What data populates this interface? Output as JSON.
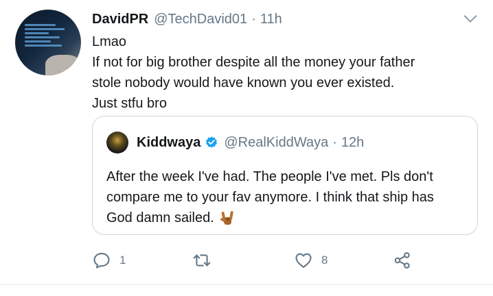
{
  "tweet": {
    "author_name": "DavidPR",
    "author_handle": "@TechDavid01",
    "separator": "·",
    "time": "11h",
    "lines": [
      "Lmao",
      "If not for big brother despite all the money your father",
      "stole nobody would have known you ever existed.",
      "Just stfu bro"
    ]
  },
  "quoted": {
    "author_name": "Kiddwaya",
    "author_handle": "@RealKiddWaya",
    "separator": "·",
    "time": "12h",
    "verified_icon": "verified-badge-icon",
    "lines": [
      "After the week I've had. The people I've met. Pls don't",
      "compare me to your fav anymore. I think that ship has",
      "God damn sailed."
    ],
    "emoji": "sign-of-the-horns-emoji"
  },
  "actions": {
    "reply_count": "1",
    "retweet_count": "",
    "like_count": "8"
  },
  "colors": {
    "text": "#14171a",
    "secondary": "#657786",
    "verified": "#1da1f2",
    "border": "#ccd6dd"
  }
}
